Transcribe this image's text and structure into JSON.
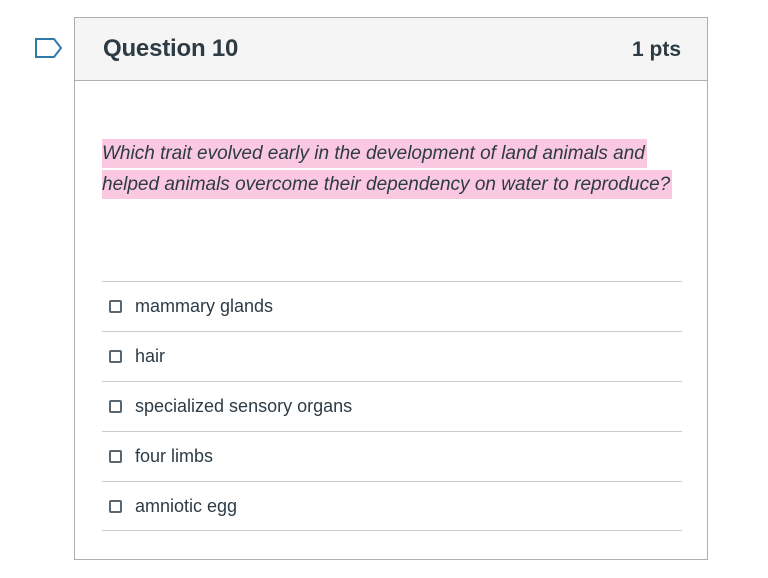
{
  "question": {
    "title": "Question 10",
    "points": "1 pts",
    "text": "Which trait evolved early in the development of land animals and helped animals overcome their dependency on water to reproduce?",
    "highlight_color": "#fac8e0",
    "flag_icon": "flag-question-icon"
  },
  "answers": [
    {
      "label": "mammary glands",
      "checked": false
    },
    {
      "label": "hair",
      "checked": false
    },
    {
      "label": "specialized sensory organs",
      "checked": false
    },
    {
      "label": "four limbs",
      "checked": false
    },
    {
      "label": "amniotic egg",
      "checked": false
    }
  ]
}
